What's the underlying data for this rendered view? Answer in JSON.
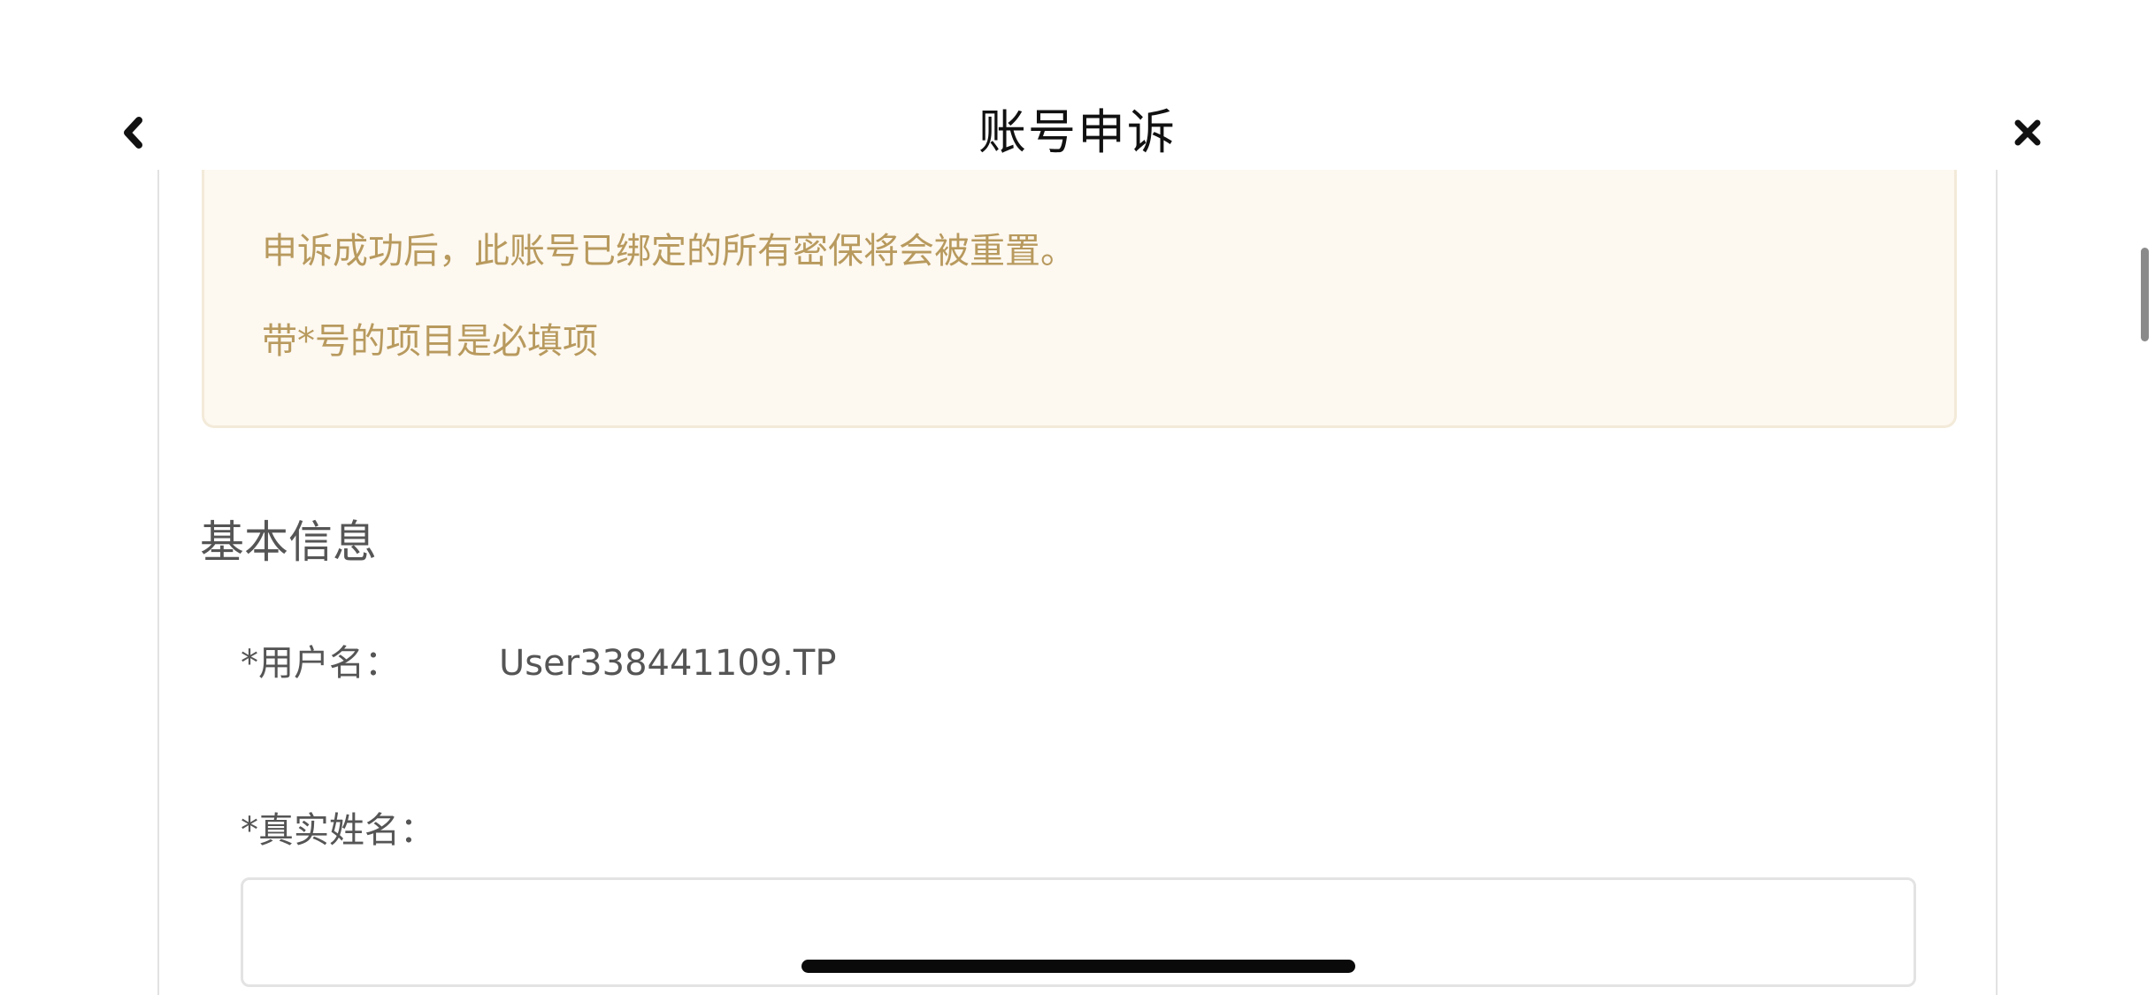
{
  "header": {
    "title": "账号申诉",
    "back_icon": "chevron-left-icon",
    "close_icon": "close-icon"
  },
  "notice": {
    "lines": [
      "申诉成功后，此账号已绑定的所有密保将会被重置。",
      "带*号的项目是必填项"
    ]
  },
  "basic_info": {
    "section_title": "基本信息",
    "username_label": "*用户名：",
    "username_value": "User338441109.TP",
    "realname_label": "*真实姓名：",
    "realname_value": "",
    "realname_placeholder": ""
  },
  "colors": {
    "notice_background": "#fdf8f0",
    "notice_text": "#b89a5e",
    "title_text": "#111111",
    "body_text": "#555555"
  }
}
